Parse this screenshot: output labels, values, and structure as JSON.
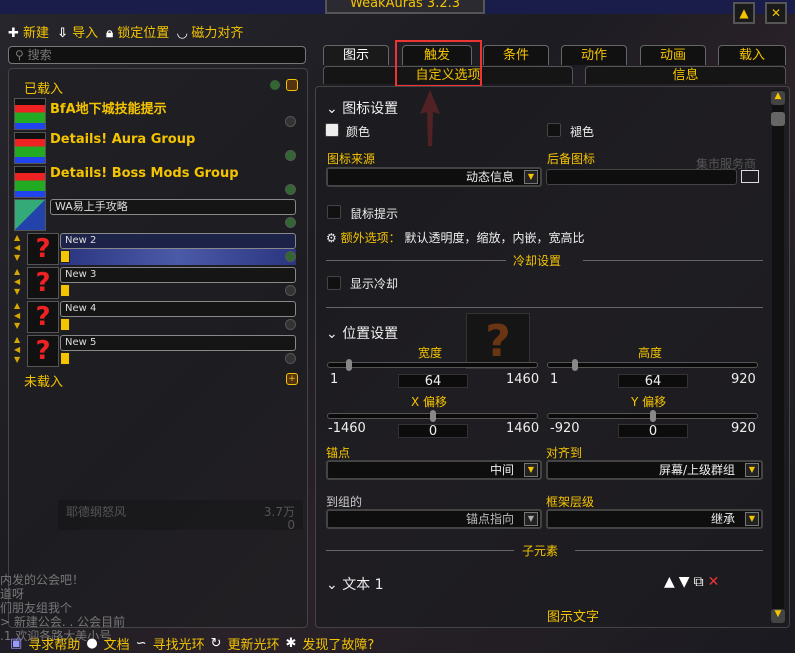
{
  "window": {
    "title": "WeakAuras 3.2.3",
    "minimize_icon": "collapse-icon",
    "close_icon": "close-icon"
  },
  "toolbar": {
    "new": "新建",
    "import": "导入",
    "lock": "锁定位置",
    "magnet": "磁力对齐"
  },
  "search": {
    "placeholder": "搜索"
  },
  "list": {
    "loaded_header": "已载入",
    "unloaded_header": "未载入",
    "items": [
      {
        "name": "BfA地下城技能提示"
      },
      {
        "name": "Details! Aura Group"
      },
      {
        "name": "Details! Boss Mods Group"
      }
    ],
    "editing_value": "WA易上手攻略",
    "children": [
      {
        "name": "New 2",
        "selected": true
      },
      {
        "name": "New 3"
      },
      {
        "name": "New 4"
      },
      {
        "name": "New 5"
      }
    ]
  },
  "tabs": {
    "row1": [
      "图示",
      "触发",
      "条件",
      "动作",
      "动画",
      "载入"
    ],
    "row2": [
      "自定义选项",
      "信息"
    ],
    "active": "图示"
  },
  "icon_settings": {
    "header": "图标设置",
    "color": "颜色",
    "desaturate": "褪色",
    "source_label": "图标来源",
    "source_value": "动态信息",
    "fallback_label": "后备图标",
    "fallback_value": "",
    "tooltip": "鼠标提示",
    "extra_label": "额外选项：",
    "extra_value": "默认透明度，缩放，内嵌，宽高比",
    "color_swatch": "#ffffff"
  },
  "cooldown": {
    "header": "冷却设置",
    "show": "显示冷却"
  },
  "position": {
    "header": "位置设置",
    "width": {
      "label": "宽度",
      "min": "1",
      "max": "1460",
      "value": "64"
    },
    "height": {
      "label": "高度",
      "min": "1",
      "max": "920",
      "value": "64"
    },
    "xoff": {
      "label": "X 偏移",
      "min": "-1460",
      "max": "1460",
      "value": "0"
    },
    "yoff": {
      "label": "Y 偏移",
      "min": "-920",
      "max": "920",
      "value": "0"
    },
    "anchor_label": "锚点",
    "anchor_value": "中间",
    "align_label": "对齐到",
    "align_value": "屏幕/上级群组",
    "to_group_label": "到组的",
    "to_group_value": "锚点指向",
    "strata_label": "框架层级",
    "strata_value": "继承"
  },
  "subelements": {
    "header": "子元素",
    "item": "文本 1",
    "sub": "图示文字"
  },
  "footer": {
    "help": "寻求帮助",
    "docs": "文档",
    "find": "寻找光环",
    "update": "更新光环",
    "bug": "发现了故障?"
  },
  "background_text": {
    "market": "集市服务商",
    "bar_name": "耶德纲怒风",
    "bar_value": "3.7万",
    "bar_value2": "0",
    "chat": [
      "内发的公会吧！",
      "道呀",
      "们朋友组我个",
      "> 新建公会. . 公会目前",
      ".1 欢迎各路大美小号"
    ]
  },
  "accent": "#f5c400",
  "highlight": "#e33333"
}
